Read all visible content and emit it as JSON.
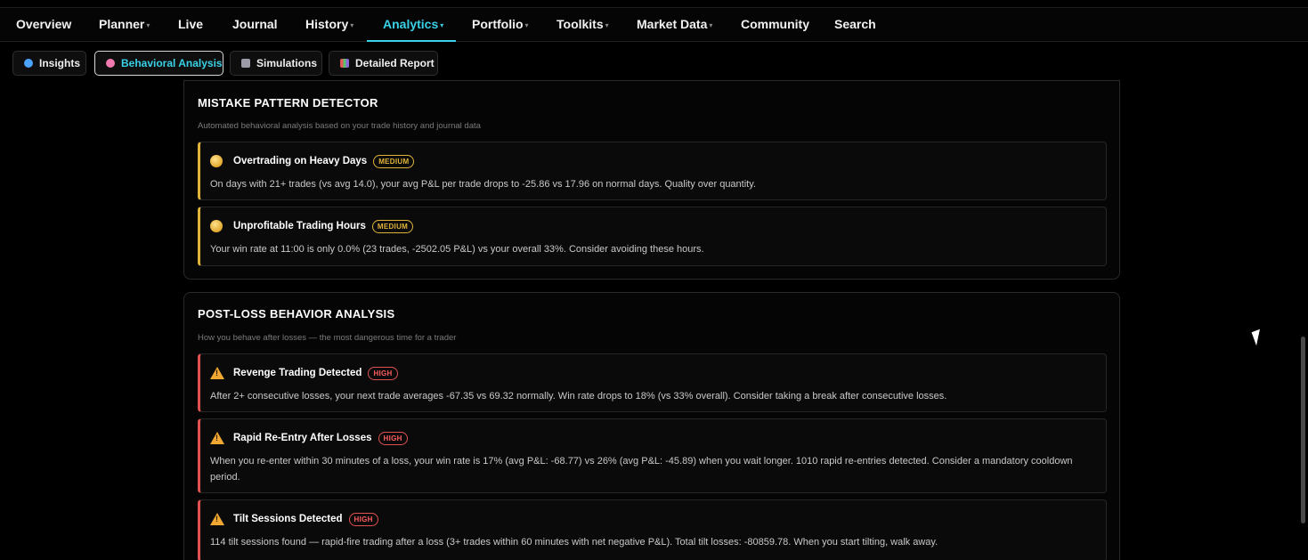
{
  "nav": {
    "items": [
      {
        "label": "Overview",
        "dropdown": false,
        "active": false
      },
      {
        "label": "Planner",
        "dropdown": true,
        "active": false
      },
      {
        "label": "Live",
        "dropdown": false,
        "active": false
      },
      {
        "label": "Journal",
        "dropdown": false,
        "active": false
      },
      {
        "label": "History",
        "dropdown": true,
        "active": false
      },
      {
        "label": "Analytics",
        "dropdown": true,
        "active": true
      },
      {
        "label": "Portfolio",
        "dropdown": true,
        "active": false
      },
      {
        "label": "Toolkits",
        "dropdown": true,
        "active": false
      },
      {
        "label": "Market Data",
        "dropdown": true,
        "active": false
      },
      {
        "label": "Community",
        "dropdown": false,
        "active": false
      },
      {
        "label": "Search",
        "dropdown": false,
        "active": false
      }
    ],
    "caret": "▾"
  },
  "subtabs": [
    {
      "label": "Insights",
      "icon": "magnifier-icon",
      "icon_color": "#4aa3ff",
      "active": false
    },
    {
      "label": "Behavioral Analysis",
      "icon": "brain-icon",
      "icon_color": "#f07ab0",
      "active": true
    },
    {
      "label": "Simulations",
      "icon": "dice-icon",
      "icon_color": "#9a9aa8",
      "active": false
    },
    {
      "label": "Detailed Report",
      "icon": "bar-chart-icon",
      "icon_color": "#8a6ad8",
      "active": false
    }
  ],
  "mistake_panel": {
    "title": "MISTAKE PATTERN DETECTOR",
    "subtitle": "Automated behavioral analysis based on your trade history and journal data",
    "cards": [
      {
        "title": "Overtrading on Heavy Days",
        "severity": "MEDIUM",
        "description": "On days with 21+ trades (vs avg 14.0), your avg P&L per trade drops to -25.86 vs 17.96 on normal days. Quality over quantity."
      },
      {
        "title": "Unprofitable Trading Hours",
        "severity": "MEDIUM",
        "description": "Your win rate at 11:00 is only 0.0% (23 trades, -2502.05 P&L) vs your overall 33%. Consider avoiding these hours."
      }
    ]
  },
  "postloss_panel": {
    "title": "POST-LOSS BEHAVIOR ANALYSIS",
    "subtitle": "How you behave after losses — the most dangerous time for a trader",
    "cards": [
      {
        "title": "Revenge Trading Detected",
        "severity": "HIGH",
        "description": "After 2+ consecutive losses, your next trade averages -67.35 vs 69.32 normally. Win rate drops to 18% (vs 33% overall). Consider taking a break after consecutive losses."
      },
      {
        "title": "Rapid Re-Entry After Losses",
        "severity": "HIGH",
        "description": "When you re-enter within 30 minutes of a loss, your win rate is 17% (avg P&L: -68.77) vs 26% (avg P&L: -45.89) when you wait longer. 1010 rapid re-entries detected. Consider a mandatory cooldown period."
      },
      {
        "title": "Tilt Sessions Detected",
        "severity": "HIGH",
        "description": "114 tilt sessions found — rapid-fire trading after a loss (3+ trades within 60 minutes with net negative P&L). Total tilt losses: -80859.78. When you start tilting, walk away."
      }
    ]
  },
  "colors": {
    "accent": "#3ad1e6",
    "medium": "#e0b33a",
    "high": "#e05252"
  }
}
